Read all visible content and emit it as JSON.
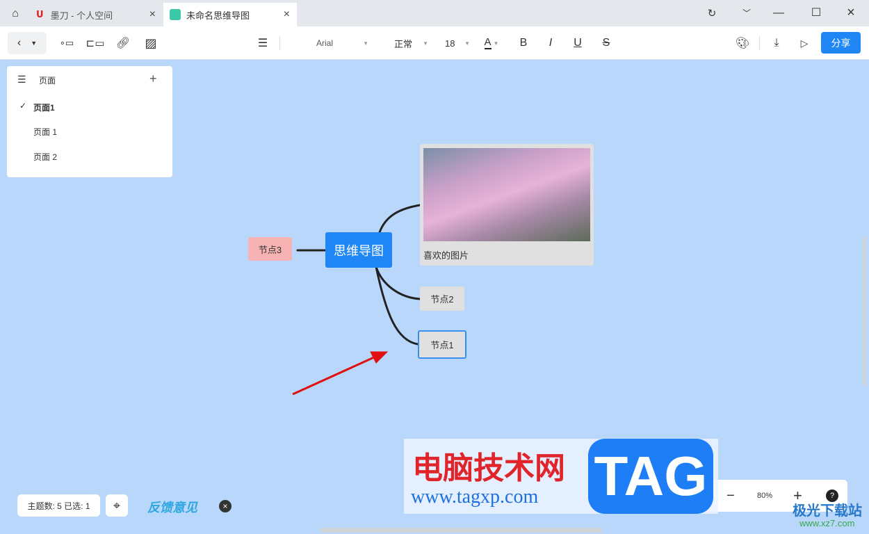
{
  "tabs": [
    {
      "label": "墨刀 - 个人空间"
    },
    {
      "label": "未命名思维导图"
    }
  ],
  "toolbar": {
    "font": "Arial",
    "weight": "正常",
    "size": "18",
    "bold": "B",
    "italic": "I",
    "underline": "U",
    "strike": "S",
    "font_color": "A",
    "share": "分享"
  },
  "pages": {
    "title": "页面",
    "items": [
      {
        "label": "页面1",
        "active": true
      },
      {
        "label": "页面 1"
      },
      {
        "label": "页面 2"
      }
    ]
  },
  "mindmap": {
    "root": "思维导图",
    "image_caption": "喜欢的图片",
    "nodes": [
      "节点3",
      "节点2",
      "节点1"
    ],
    "colors": {
      "root": "#1e87f5",
      "node3": "#f7b3b3",
      "node": "#e0e0e0",
      "selected": "#3a8ef0"
    }
  },
  "status": {
    "count": "主题数: 5 已选: 1",
    "feedback": "反馈意见",
    "zoom": "80%",
    "help": "?"
  },
  "watermark": {
    "cn": "电脑技术网",
    "url": "www.tagxp.com",
    "tag": "TAG",
    "site": "极光下载站",
    "site_url": "www.xz7.com"
  }
}
